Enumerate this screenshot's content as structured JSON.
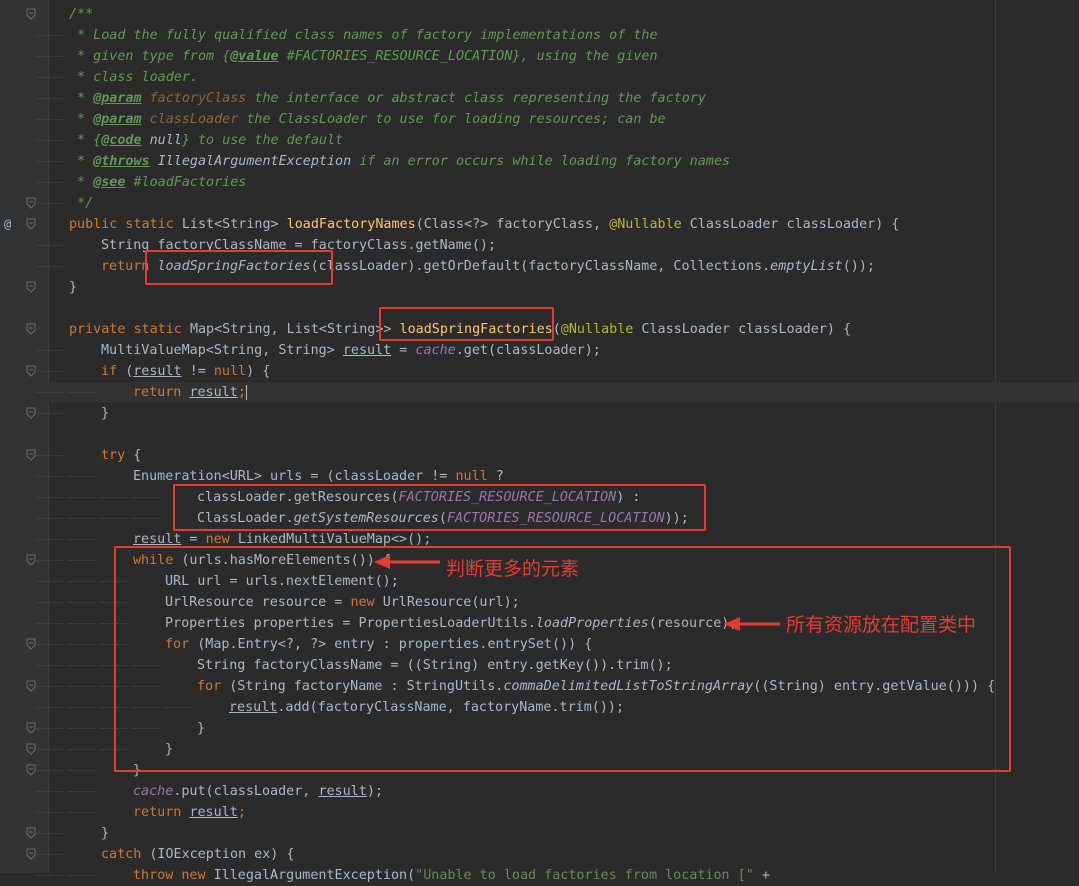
{
  "editor": {
    "language": "java",
    "theme": "darcula",
    "gutter_marker": "@",
    "fold_icon": "fold-arrow-icon"
  },
  "annotations": {
    "note1": "判断更多的元素",
    "note2": "所有资源放在配置类中",
    "color": "#e53b31"
  },
  "code_lines": [
    [
      "/**"
    ],
    [
      " * Load the fully qualified class names of factory implementations of the"
    ],
    [
      " * given type from {",
      "@value",
      " #FACTORIES_RESOURCE_LOCATION}, using the given"
    ],
    [
      " * class loader."
    ],
    [
      " * ",
      "@param",
      " ",
      "factoryClass",
      " the interface or abstract class representing the factory"
    ],
    [
      " * ",
      "@param",
      " ",
      "classLoader",
      " the ClassLoader to use for loading resources; can be"
    ],
    [
      " * {",
      "@code",
      " ",
      "null",
      "} to use the default"
    ],
    [
      " * ",
      "@throws",
      " ",
      "IllegalArgumentException",
      " if an error occurs while loading factory names"
    ],
    [
      " * ",
      "@see",
      " #loadFactories"
    ],
    [
      " */"
    ],
    [
      "public static ",
      "List<String> ",
      "loadFactoryNames",
      "(Class<?> factoryClass, ",
      "@Nullable",
      " ClassLoader classLoader) {"
    ],
    [
      "String factoryClassName = factoryClass.getName();"
    ],
    [
      "return ",
      "loadSpringFactories",
      "(classLoader).getOrDefault(factoryClassName, Collections.",
      "emptyList",
      "());"
    ],
    [
      "}"
    ],
    [
      ""
    ],
    [
      "private static ",
      "Map<String, List<String>> ",
      "loadSpringFactories",
      "(",
      "@Nullable",
      " ClassLoader classLoader) {"
    ],
    [
      "MultiValueMap<String, String> ",
      "result",
      " = ",
      "cache",
      ".get(classLoader);"
    ],
    [
      "if ",
      "(",
      "result",
      " != ",
      "null",
      ") {"
    ],
    [
      "return ",
      "result",
      ";"
    ],
    [
      "}"
    ],
    [
      ""
    ],
    [
      "try ",
      "{"
    ],
    [
      "Enumeration<URL> urls = (classLoader != ",
      "null",
      " ?"
    ],
    [
      "classLoader.getResources(",
      "FACTORIES_RESOURCE_LOCATION",
      ") :"
    ],
    [
      "ClassLoader.",
      "getSystemResources",
      "(",
      "FACTORIES_RESOURCE_LOCATION",
      "));"
    ],
    [
      "result",
      " = ",
      "new ",
      "LinkedMultiValueMap<>();"
    ],
    [
      "while ",
      "(urls.hasMoreElements()) {"
    ],
    [
      "URL url = urls.nextElement();"
    ],
    [
      "UrlResource resource = ",
      "new ",
      "UrlResource(url);"
    ],
    [
      "Properties properties = PropertiesLoaderUtils.",
      "loadProperties",
      "(resource);"
    ],
    [
      "for ",
      "(Map.Entry<?, ?> entry : properties.entrySet()) {"
    ],
    [
      "String factoryClassName = ((String) entry.getKey()).trim();"
    ],
    [
      "for ",
      "(String factoryName : StringUtils.",
      "commaDelimitedListToStringArray",
      "((String) entry.getValue())) {"
    ],
    [
      "result",
      ".add(factoryClassName, factoryName.trim());"
    ],
    [
      "}"
    ],
    [
      "}"
    ],
    [
      "}"
    ],
    [
      "cache",
      ".put(classLoader, ",
      "result",
      ");"
    ],
    [
      "return ",
      "result",
      ";"
    ],
    [
      "}"
    ],
    [
      "catch ",
      "(IOException ex) {"
    ],
    [
      "throw new ",
      "IllegalArgumentException(",
      "\"Unable to load factories from location [\"",
      " +"
    ]
  ]
}
